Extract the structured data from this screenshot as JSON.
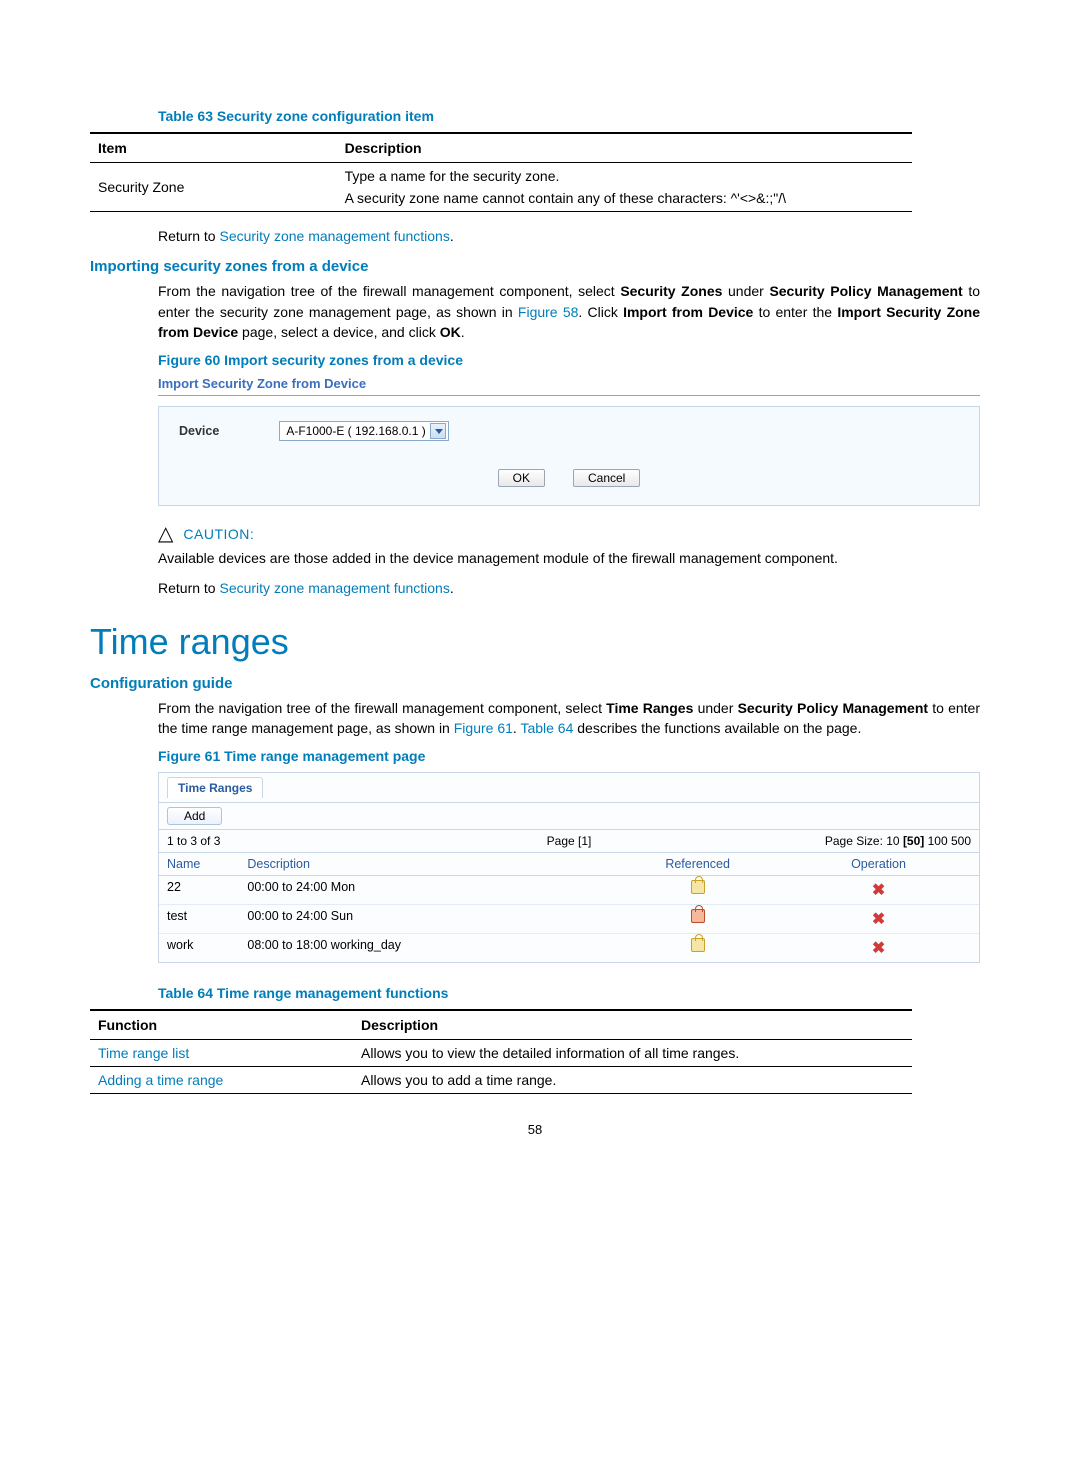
{
  "table63": {
    "caption": "Table 63 Security zone configuration item",
    "headers": {
      "item": "Item",
      "desc": "Description"
    },
    "row": {
      "item": "Security Zone",
      "desc1": "Type a name for the security zone.",
      "desc2": "A security zone name cannot contain any of these characters: ^'<>&:;\"/\\"
    }
  },
  "return1": {
    "prefix": "Return to ",
    "link": "Security zone management functions",
    "suffix": "."
  },
  "sectionImport": {
    "title": "Importing security zones from a device",
    "para": {
      "pre": "From the navigation tree of the firewall management component, select ",
      "b1": "Security Zones",
      "t1": " under ",
      "b2": "Security Policy Management",
      "t2": " to enter the security zone management page, as shown in ",
      "figref": "Figure 58",
      "t3": ". Click ",
      "b3": "Import from Device",
      "t4": " to enter the ",
      "b4": "Import Security Zone from Device",
      "t5": " page, select a device, and click ",
      "b5": "OK",
      "t6": "."
    },
    "figcap": "Figure 60 Import security zones from a device",
    "figtitle": "Import Security Zone from Device",
    "deviceLabel": "Device",
    "deviceValue": "A-F1000-E ( 192.168.0.1 )",
    "okBtn": "OK",
    "cancelBtn": "Cancel"
  },
  "caution": {
    "label": "CAUTION:",
    "text": "Available devices are those added in the device management module of the firewall management component."
  },
  "return2": {
    "prefix": "Return to ",
    "link": "Security zone management functions",
    "suffix": "."
  },
  "timeRanges": {
    "h1": "Time ranges",
    "h3": "Configuration guide",
    "para": {
      "pre": "From the navigation tree of the firewall management component, select ",
      "b1": "Time Ranges",
      "t1": " under ",
      "b2": "Security Policy Management",
      "t2": " to enter the time range management page, as shown in ",
      "figref": "Figure 61",
      "t3": ". ",
      "tblref": "Table 64",
      "t4": " describes the functions available on the page."
    },
    "figcap": "Figure 61 Time range management page",
    "panel": {
      "tab": "Time Ranges",
      "add": "Add",
      "range": "1 to 3 of 3",
      "page": "Page [1]",
      "psz_pre": "Page Size: 10 ",
      "psz_sel": "[50]",
      "psz_post": " 100 500",
      "cols": {
        "name": "Name",
        "desc": "Description",
        "ref": "Referenced",
        "op": "Operation"
      },
      "rows": [
        {
          "name": "22",
          "desc": "00:00 to 24:00 Mon",
          "ref": "free"
        },
        {
          "name": "test",
          "desc": "00:00 to 24:00 Sun",
          "ref": "ref"
        },
        {
          "name": "work",
          "desc": "08:00 to 18:00 working_day",
          "ref": "free"
        }
      ]
    }
  },
  "table64": {
    "caption": "Table 64 Time range management functions",
    "headers": {
      "fn": "Function",
      "desc": "Description"
    },
    "rows": [
      {
        "fn": "Time range list",
        "desc": "Allows you to view the detailed information of all time ranges."
      },
      {
        "fn": "Adding a time range",
        "desc": "Allows you to add a time range."
      }
    ]
  },
  "pageNo": "58"
}
